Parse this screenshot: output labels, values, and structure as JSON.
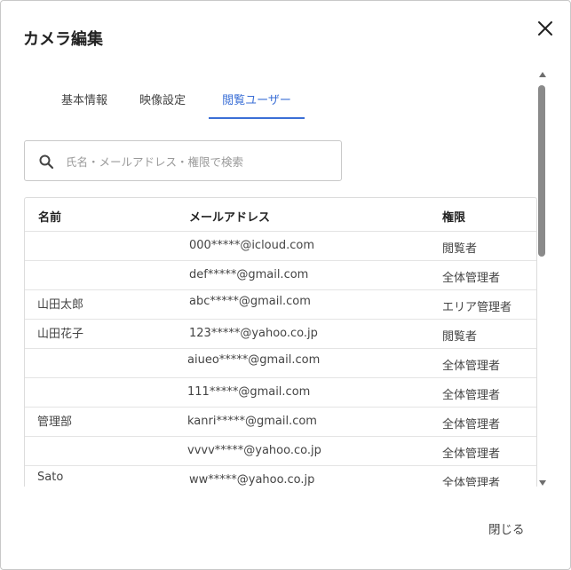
{
  "dialog": {
    "title": "カメラ編集"
  },
  "tabs": [
    {
      "label": "基本情報",
      "active": false
    },
    {
      "label": "映像設定",
      "active": false
    },
    {
      "label": "閲覧ユーザー",
      "active": true
    }
  ],
  "search": {
    "placeholder": "氏名・メールアドレス・権限で検索",
    "value": ""
  },
  "table": {
    "headers": [
      "名前",
      "メールアドレス",
      "権限"
    ],
    "rows": [
      {
        "name": "",
        "email": "000*****@icloud.com",
        "role": "閲覧者"
      },
      {
        "name": "",
        "email": "def*****@gmail.com",
        "role": "全体管理者"
      },
      {
        "name": "山田太郎",
        "email": "abc*****@gmail.com",
        "role": "エリア管理者"
      },
      {
        "name": "山田花子",
        "email": "123*****@yahoo.co.jp",
        "role": "閲覧者"
      },
      {
        "name": "",
        "email": "aiueo*****@gmail.com",
        "role": "全体管理者"
      },
      {
        "name": "",
        "email": "111*****@gmail.com",
        "role": "全体管理者"
      },
      {
        "name": "管理部",
        "email": "kanri*****@gmail.com",
        "role": "全体管理者"
      },
      {
        "name": "",
        "email": "vvvv*****@yahoo.co.jp",
        "role": "全体管理者"
      },
      {
        "name": "Sato",
        "email": "ww*****@yahoo.co.jp",
        "role": "全体管理者"
      }
    ]
  },
  "footer": {
    "close_label": "閉じる"
  },
  "colors": {
    "accent": "#3b6fd6",
    "border": "#dcdcdc",
    "scrollbar": "#8a8a8a"
  },
  "icons": {
    "close": "close-icon",
    "search": "search-icon"
  }
}
